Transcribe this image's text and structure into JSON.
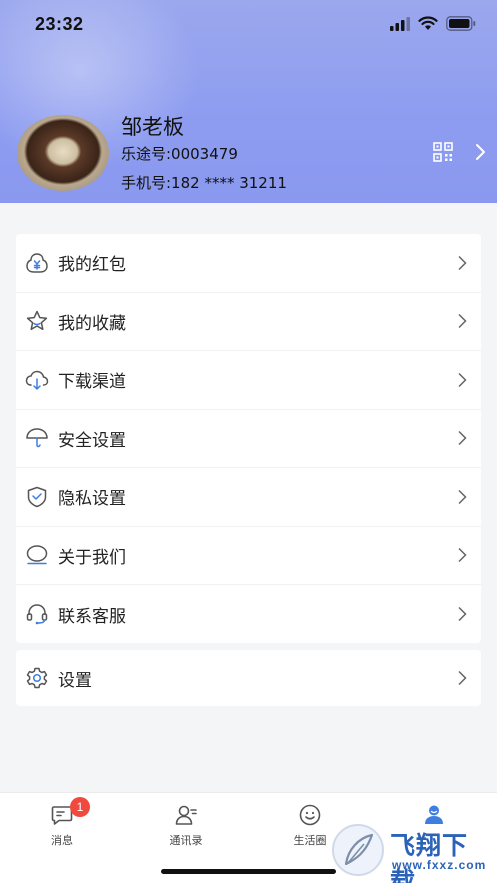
{
  "status_bar": {
    "time": "23:32"
  },
  "profile": {
    "name": "邹老板",
    "account_id": "乐途号:0003479",
    "phone": "手机号:182 **** 31211"
  },
  "menu": {
    "items": [
      {
        "label": "我的红包",
        "icon": "red-envelope-icon"
      },
      {
        "label": "我的收藏",
        "icon": "star-icon"
      },
      {
        "label": "下载渠道",
        "icon": "cloud-download-icon"
      },
      {
        "label": "安全设置",
        "icon": "umbrella-icon"
      },
      {
        "label": "隐私设置",
        "icon": "shield-icon"
      },
      {
        "label": "关于我们",
        "icon": "chat-bubble-icon"
      },
      {
        "label": "联系客服",
        "icon": "headset-icon"
      }
    ],
    "settings": {
      "label": "设置",
      "icon": "gear-icon"
    }
  },
  "tabbar": {
    "tabs": [
      {
        "label": "消息",
        "icon": "message-icon",
        "badge": "1"
      },
      {
        "label": "通讯录",
        "icon": "contacts-icon"
      },
      {
        "label": "生活圈",
        "icon": "smile-icon"
      },
      {
        "label": "",
        "icon": "profile-icon",
        "active": true
      }
    ]
  },
  "watermark": {
    "title": "飞翔下载",
    "url": "www.fxxz.com"
  },
  "colors": {
    "header": "#8d9cf0",
    "accent": "#3d7ee0",
    "icon_blue": "#4a90e2",
    "badge": "#f04a3e"
  }
}
